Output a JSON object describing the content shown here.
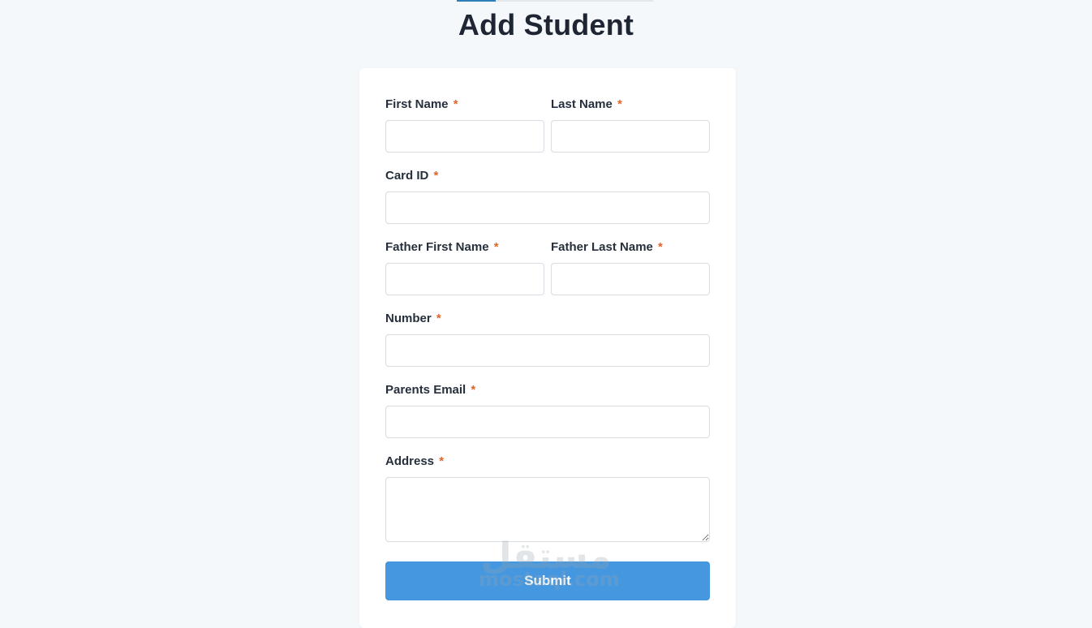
{
  "page": {
    "title": "Add Student"
  },
  "form": {
    "required_marker": "*",
    "fields": {
      "first_name": {
        "label": "First Name",
        "value": "",
        "placeholder": ""
      },
      "last_name": {
        "label": "Last Name",
        "value": "",
        "placeholder": ""
      },
      "card_id": {
        "label": "Card ID",
        "value": "",
        "placeholder": ""
      },
      "father_first_name": {
        "label": "Father First Name",
        "value": "",
        "placeholder": ""
      },
      "father_last_name": {
        "label": "Father Last Name",
        "value": "",
        "placeholder": ""
      },
      "number": {
        "label": "Number",
        "value": "",
        "placeholder": ""
      },
      "parents_email": {
        "label": "Parents Email",
        "value": "",
        "placeholder": ""
      },
      "address": {
        "label": "Address",
        "value": "",
        "placeholder": ""
      }
    },
    "submit_label": "Submit"
  },
  "watermark": {
    "arabic": "مستقل",
    "latin": "mostaql.com"
  },
  "colors": {
    "background": "#f5f8fb",
    "card": "#ffffff",
    "accent": "#4598e0",
    "required": "#e0662b",
    "title": "#1e2533"
  }
}
